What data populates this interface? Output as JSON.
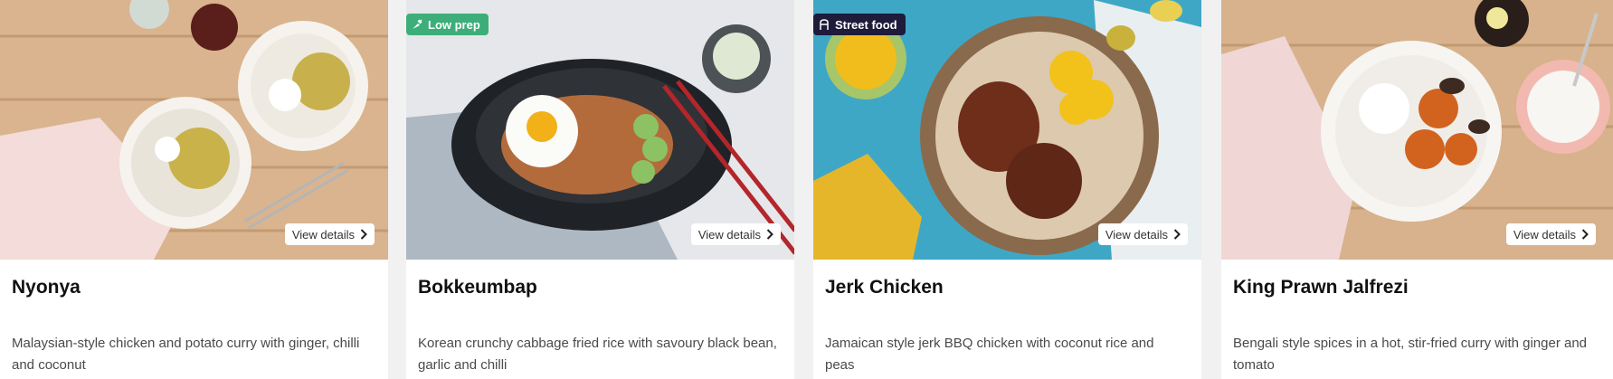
{
  "cards": [
    {
      "title": "Nyonya",
      "description": "Malaysian-style chicken and potato curry with ginger, chilli and coconut",
      "view_details": "View details",
      "badge": null
    },
    {
      "title": "Bokkeumbap",
      "description": "Korean crunchy cabbage fried rice with savoury black bean, garlic and chilli",
      "view_details": "View details",
      "badge": {
        "label": "Low prep",
        "icon": "carrot-icon",
        "color": "#3dae7a"
      }
    },
    {
      "title": "Jerk Chicken",
      "description": "Jamaican style jerk BBQ chicken with coconut rice and peas",
      "view_details": "View details",
      "badge": {
        "label": "Street food",
        "icon": "food-truck-icon",
        "color": "#1e1b3b"
      }
    },
    {
      "title": "King Prawn Jalfrezi",
      "description": "Bengali style spices in a hot, stir-fried curry with ginger and tomato",
      "view_details": "View details",
      "badge": null
    }
  ]
}
